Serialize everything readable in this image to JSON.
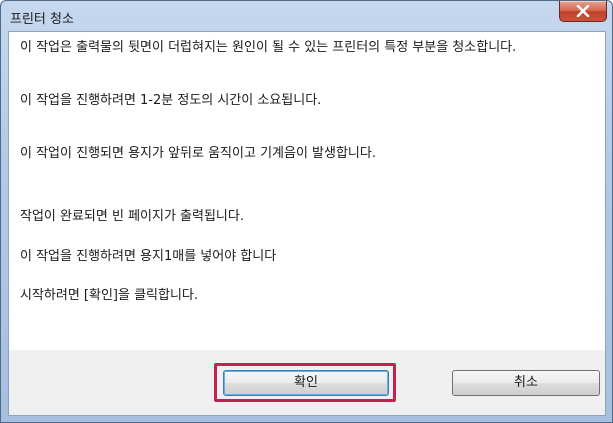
{
  "window": {
    "title": "프린터 청소",
    "close_label": "x"
  },
  "content": {
    "paragraphs": [
      "이 작업은 출력물의 뒷면이 더럽혀지는 원인이 될 수 있는 프린터의 특정 부분을 청소합니다.",
      "이 작업을 진행하려면 1-2분 정도의 시간이 소요됩니다.",
      "이 작업이 진행되면 용지가 앞뒤로 움직이고 기계음이 발생합니다.",
      "작업이 완료되면 빈 페이지가 출력됩니다.",
      "이 작업을 진행하려면 용지1매를 넣어야 합니다",
      "시작하려면 [확인]을 클릭합니다."
    ]
  },
  "buttons": {
    "confirm_label": "확인",
    "cancel_label": "취소"
  },
  "colors": {
    "highlight": "#c4224e",
    "title_bar": "#b2c8e6"
  }
}
